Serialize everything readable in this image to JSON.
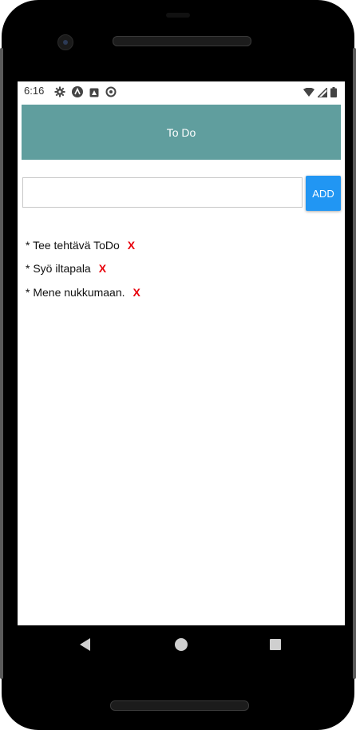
{
  "status_bar": {
    "time": "6:16",
    "left_icons": [
      "settings-icon",
      "app-a-icon",
      "app-box-icon",
      "sync-icon"
    ],
    "right_icons": [
      "wifi-icon",
      "signal-icon",
      "battery-icon"
    ]
  },
  "header": {
    "title": "To Do",
    "background": "#609e9e"
  },
  "input": {
    "value": "",
    "placeholder": ""
  },
  "add_button": {
    "label": "ADD",
    "color": "#2196f3"
  },
  "todos": [
    {
      "text": "* Tee tehtävä ToDo",
      "delete_label": "X"
    },
    {
      "text": "* Syö iltapala",
      "delete_label": "X"
    },
    {
      "text": "* Mene nukkumaan.",
      "delete_label": "X"
    }
  ],
  "colors": {
    "delete": "#e8000b"
  },
  "nav_bar": {
    "buttons": [
      "back-icon",
      "home-icon",
      "recents-icon"
    ]
  }
}
